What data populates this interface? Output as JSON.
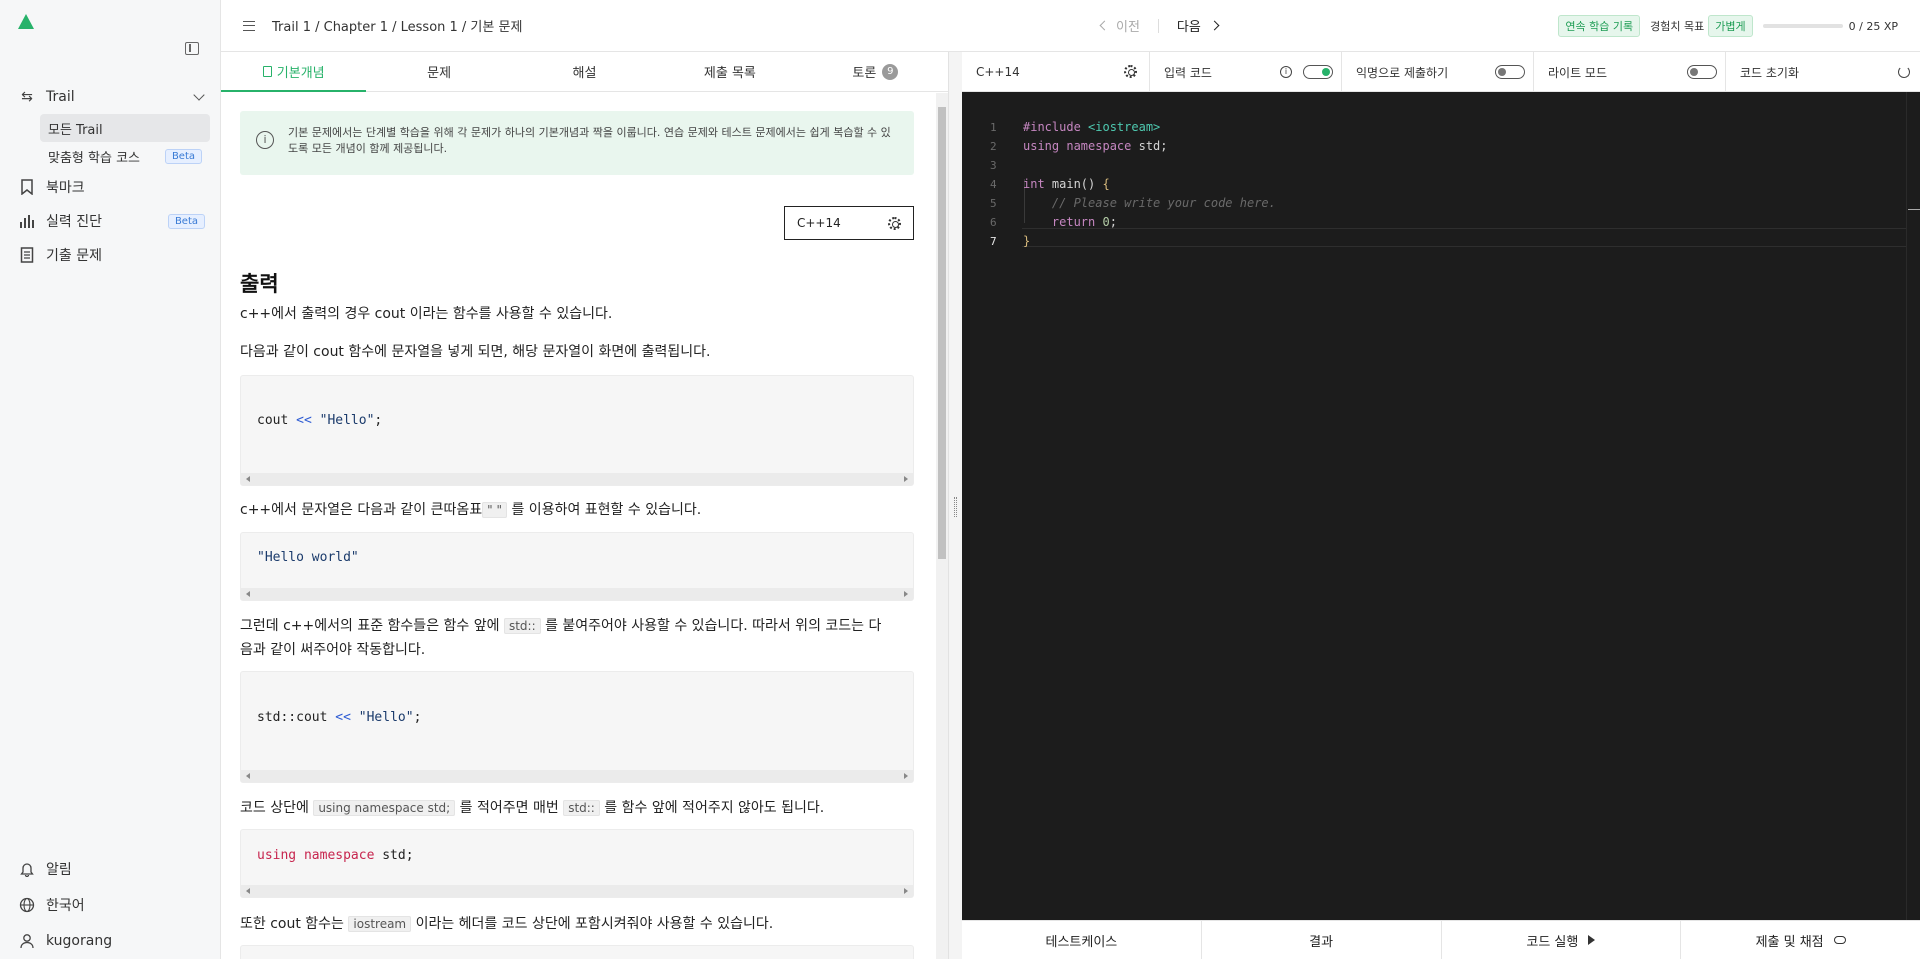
{
  "sidebar": {
    "trail_label": "Trail",
    "sub_items": [
      {
        "label": "모든 Trail"
      },
      {
        "label": "맞춤형 학습 코스",
        "badge": "Beta"
      }
    ],
    "items": [
      {
        "label": "북마크",
        "icon": "bookmark-icon"
      },
      {
        "label": "실력 진단",
        "icon": "bar-chart-icon",
        "badge": "Beta"
      },
      {
        "label": "기출 문제",
        "icon": "document-icon"
      }
    ],
    "bottom": [
      {
        "label": "알림",
        "icon": "bell-icon"
      },
      {
        "label": "한국어",
        "icon": "globe-icon"
      },
      {
        "label": "kugorang",
        "icon": "user-icon"
      }
    ]
  },
  "header": {
    "breadcrumb": "Trail 1 / Chapter 1 / Lesson 1 / 기본 문제",
    "prev_label": "이전",
    "next_label": "다음",
    "streak_label": "연속 학습 기록",
    "xp_goal_label": "경험치 목표",
    "xp_goal_value": "가볍게",
    "xp_text": "0 / 25 XP",
    "xp_progress": 0
  },
  "tabs": [
    {
      "label": "기본개념",
      "active": true
    },
    {
      "label": "문제"
    },
    {
      "label": "해설"
    },
    {
      "label": "제출 목록"
    },
    {
      "label": "토론",
      "count": "9"
    }
  ],
  "content": {
    "info_text": "기본 문제에서는 단계별 학습을 위해 각 문제가 하나의 기본개념과 짝을 이룹니다. 연습 문제와 테스트 문제에서는 쉽게 복습할 수 있도록 모든 개념이 함께 제공됩니다.",
    "language": "C++14",
    "heading": "출력",
    "p1": "c++에서 출력의 경우 cout 이라는 함수를 사용할 수 있습니다.",
    "p2": "다음과 같이 cout 함수에 문자열을 넣게 되면, 해당 문자열이 화면에 출력됩니다.",
    "code1": {
      "a": "cout ",
      "b": "<<",
      "c": " \"Hello\"",
      "d": ";"
    },
    "p3a": "c++에서 문자열은 다음과 같이 큰따옴표",
    "p3code": "\" \"",
    "p3b": " 를 이용하여 표현할 수 있습니다.",
    "code2": "\"Hello world\"",
    "p4a": "그런데 c++에서의 표준 함수들은 함수 앞에",
    "p4code": "std::",
    "p4b": " 를 붙여주어야 사용할 수 있습니다. 따라서 위의 코드는 다",
    "p4c": "음과 같이 써주어야 작동합니다.",
    "code3": {
      "a": "std::cout ",
      "b": "<<",
      "c": " \"Hello\"",
      "d": ";"
    },
    "p5a": "코드 상단에",
    "p5code1": "using namespace std;",
    "p5b": " 를 적어주면 매번",
    "p5code2": "std::",
    "p5c": " 를 함수 앞에 적어주지 않아도 됩니다.",
    "code4": {
      "a": "using namespace",
      "b": " std;"
    },
    "p6a": "또한 cout 함수는",
    "p6code": "iostream",
    "p6b": " 이라는 헤더를 코드 상단에 포함시켜줘야 사용할 수 있습니다."
  },
  "editor_toolbar": {
    "language": "C++14",
    "input_code_label": "입력 코드",
    "input_code_on": true,
    "anon_submit_label": "익명으로 제출하기",
    "anon_submit_on": false,
    "light_mode_label": "라이트 모드",
    "light_mode_on": false,
    "reset_label": "코드 초기화"
  },
  "editor": {
    "line_numbers": [
      "1",
      "2",
      "3",
      "4",
      "5",
      "6",
      "7"
    ],
    "l1a": "#include ",
    "l1b": "<iostream>",
    "l2a": "using namespace",
    "l2b": " std;",
    "l4a": "int",
    "l4b": " main() ",
    "l4c": "{",
    "l5": "    // Please write your code here.",
    "l6a": "    return ",
    "l6b": "0",
    "l6c": ";",
    "l7": "}"
  },
  "bottom_bar": {
    "testcase": "테스트케이스",
    "result": "결과",
    "run": "코드 실행",
    "submit": "제출 및 채점"
  },
  "colors": {
    "accent": "#27b26a",
    "editor_bg": "#1c1c1c"
  }
}
